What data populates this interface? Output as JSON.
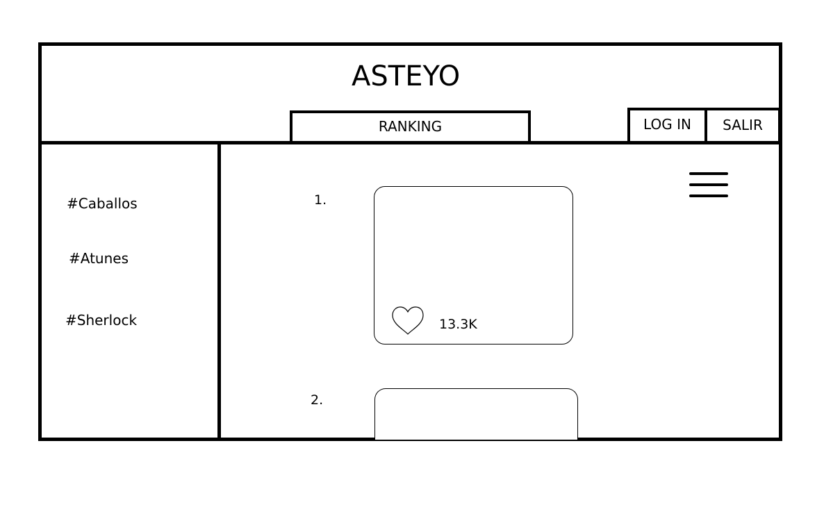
{
  "header": {
    "title": "ASTEYO",
    "ranking_label": "RANKING",
    "login_label": "LOG IN",
    "salir_label": "SALIR"
  },
  "sidebar": {
    "tags": [
      "#Caballos",
      "#Atunes",
      "#Sherlock"
    ]
  },
  "ranking": {
    "items": [
      {
        "rank": "1.",
        "likes": "13.3K"
      },
      {
        "rank": "2."
      }
    ]
  },
  "icons": {
    "menu": "hamburger-menu-icon",
    "like": "heart-outline-icon"
  }
}
